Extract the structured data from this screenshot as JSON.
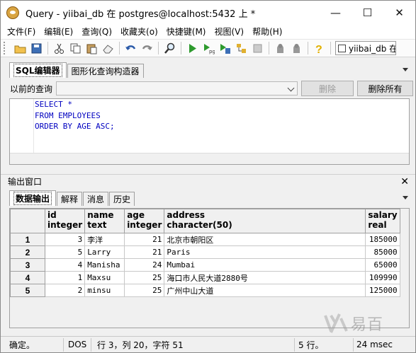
{
  "window": {
    "title": "Query - yiibai_db 在  postgres@localhost:5432 上 *",
    "minimize": "—",
    "maximize": "☐",
    "close": "✕"
  },
  "menu": [
    "文件(F)",
    "编辑(E)",
    "查询(Q)",
    "收藏夹(o)",
    "快捷键(M)",
    "视图(V)",
    "帮助(H)"
  ],
  "toolbar": {
    "icons": [
      "open-icon",
      "save-icon",
      "cut-icon",
      "copy-icon",
      "paste-icon",
      "eraser-icon",
      "undo-icon",
      "redo-icon",
      "find-icon",
      "execute-icon",
      "execute-pgscript-icon",
      "execute-to-file-icon",
      "explain-icon",
      "stop-icon",
      "commit-icon",
      "rollback-icon",
      "help-icon"
    ],
    "db_label": "yiibai_db 在"
  },
  "editor": {
    "tabs": [
      "SQL编辑器",
      "图形化查询构造器"
    ],
    "history_label": "以前的查询",
    "delete_button": "删除",
    "delete_all_button": "删除所有",
    "sql": "SELECT *\nFROM EMPLOYEES\nORDER BY AGE ASC;"
  },
  "output": {
    "title": "输出窗口",
    "close": "✕",
    "tabs": [
      "数据输出",
      "解释",
      "消息",
      "历史"
    ],
    "columns": [
      {
        "name": "id",
        "type": "integer"
      },
      {
        "name": "name",
        "type": "text"
      },
      {
        "name": "age",
        "type": "integer"
      },
      {
        "name": "address",
        "type": "character(50)"
      },
      {
        "name": "salary",
        "type": "real"
      }
    ],
    "rows": [
      {
        "n": "1",
        "id": "3",
        "name": "李洋",
        "age": "21",
        "address": "北京市朝阳区",
        "salary": "185000"
      },
      {
        "n": "2",
        "id": "5",
        "name": "Larry",
        "age": "21",
        "address": "Paris",
        "salary": "85000"
      },
      {
        "n": "3",
        "id": "4",
        "name": "Manisha",
        "age": "24",
        "address": "Mumbai",
        "salary": "65000"
      },
      {
        "n": "4",
        "id": "1",
        "name": "Maxsu",
        "age": "25",
        "address": "海口市人民大道2880号",
        "salary": "109990"
      },
      {
        "n": "5",
        "id": "2",
        "name": "minsu",
        "age": "25",
        "address": "广州中山大道",
        "salary": "125000"
      }
    ]
  },
  "watermark": "易百",
  "status": {
    "state": "确定。",
    "encoding": "DOS",
    "position": "行 3，列 20，字符 51",
    "rows": "5 行。",
    "time": "24 msec"
  }
}
